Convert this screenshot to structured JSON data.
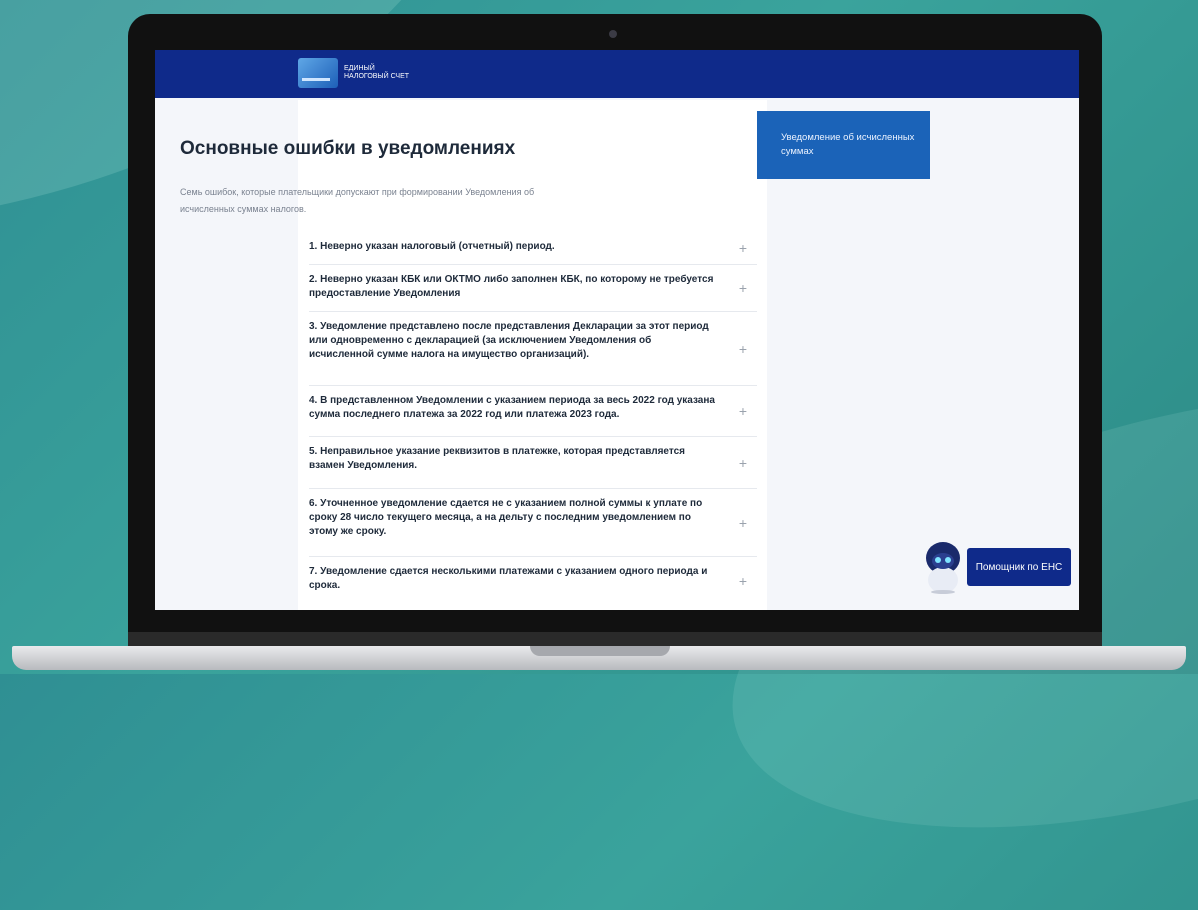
{
  "header": {
    "logo_line1": "ЕДИНЫЙ",
    "logo_line2": "НАЛОГОВЫЙ СЧЕТ"
  },
  "main": {
    "title": "Основные ошибки в уведомлениях",
    "intro": "Семь ошибок, которые плательщики допускают при формировании Уведомления об исчисленных суммах налогов.",
    "items": [
      {
        "label": "1. Неверно указан налоговый (отчетный) период."
      },
      {
        "label": "2. Неверно указан КБК или ОКТМО либо заполнен КБК, по которому не требуется предоставление Уведомления"
      },
      {
        "label": "3. Уведомление представлено после представления Декларации за этот период или одновременно с декларацией (за исключением Уведомления об исчисленной сумме налога на имущество организаций)."
      },
      {
        "label": "4. В представленном Уведомлении с указанием периода за весь 2022 год указана сумма последнего платежа за 2022 год или платежа 2023 года."
      },
      {
        "label": "5. Неправильное указание реквизитов в платежке, которая представляется взамен Уведомления."
      },
      {
        "label": "6. Уточненное уведомление сдается не с указанием полной суммы к уплате по сроку 28 число текущего месяца, а на дельту с последним уведомлением по этому же сроку."
      },
      {
        "label": "7. Уведомление сдается несколькими платежами с указанием одного периода и срока."
      }
    ],
    "expand_symbol": "+"
  },
  "sidebar": {
    "link_label": "Уведомление об исчисленных суммах"
  },
  "helper": {
    "button_label": "Помощник по ЕНС"
  },
  "colors": {
    "header": "#0f2a8a",
    "side_card": "#1b63b8",
    "background": "#2f8f93"
  }
}
